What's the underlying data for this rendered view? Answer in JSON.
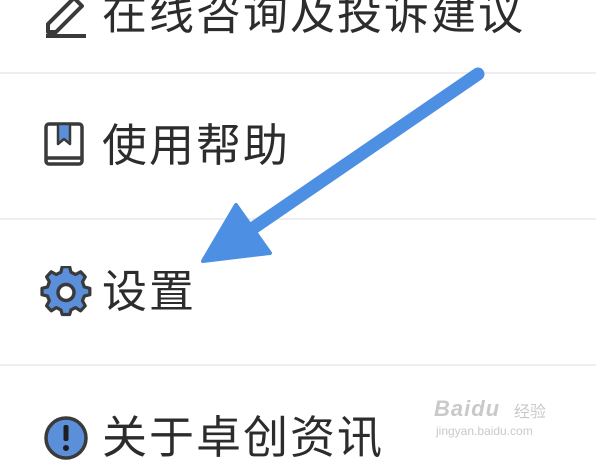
{
  "menu": {
    "items": [
      {
        "label": "在线咨询及投诉建议",
        "icon": "edit-icon"
      },
      {
        "label": "使用帮助",
        "icon": "book-icon"
      },
      {
        "label": "设置",
        "icon": "gear-icon"
      },
      {
        "label": "关于卓创资讯",
        "icon": "info-icon"
      }
    ]
  },
  "watermark": {
    "brand": "Baidu",
    "suffix": "经验",
    "domain": "jingyan.baidu.com"
  },
  "colors": {
    "arrow": "#4d8fe3",
    "icon_accent": "#5b8fd9",
    "icon_outline": "#3a3a3a",
    "text": "#2c2c2c",
    "divider": "#eeeeee"
  }
}
